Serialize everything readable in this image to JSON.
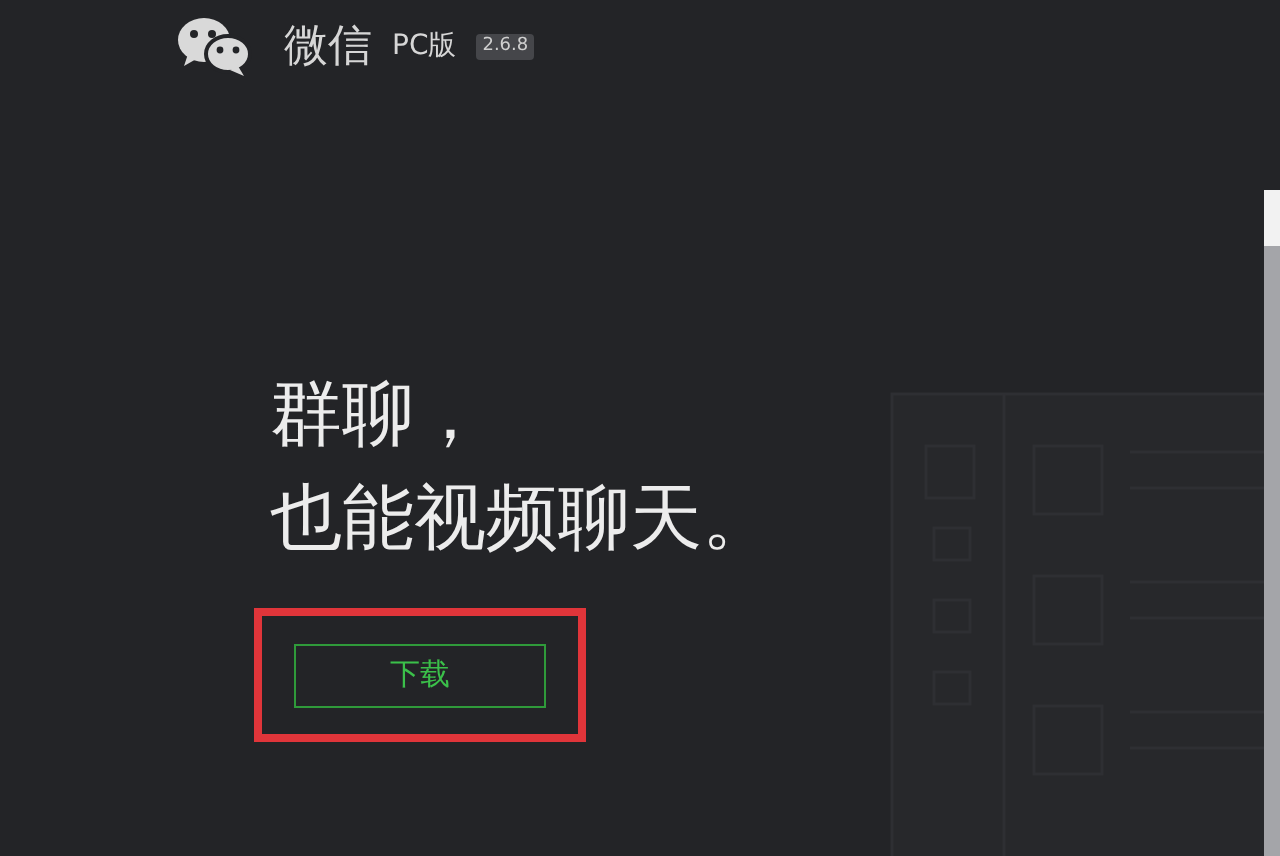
{
  "header": {
    "app_name": "微信",
    "edition": "PC版",
    "version": "2.6.8"
  },
  "headline": {
    "lines": [
      "群聊，",
      "也能视频聊天。"
    ]
  },
  "download_button": {
    "label": "下载",
    "highlighted": true
  }
}
